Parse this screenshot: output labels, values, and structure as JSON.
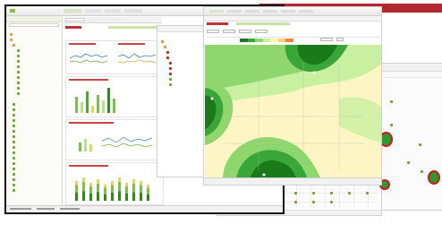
{
  "banner": {
    "color": "#b3272e"
  },
  "app": {
    "name": "...",
    "menu": [
      "...",
      "...",
      "...",
      "...",
      "..."
    ],
    "tabs": [
      "...",
      "...",
      "..."
    ],
    "status_items": [
      "...",
      "...",
      "...",
      "..."
    ]
  },
  "map_window": {
    "title": "...",
    "toolbar": [
      "...",
      "...",
      "...",
      "..."
    ],
    "legend_colors": [
      "#1a7a1a",
      "#3aa63a",
      "#8fd66e",
      "#c8f0a0",
      "#fff8b0",
      "#ffd070",
      "#ff8040"
    ]
  },
  "icons": {
    "folder": "folder-icon",
    "leaf": "plant-icon",
    "alert": "alert-marker-icon"
  },
  "colors": {
    "accent": "#b3272e",
    "green": "#4caa3c",
    "panel": "#eef3e6"
  }
}
